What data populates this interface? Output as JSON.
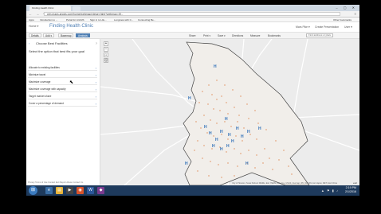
{
  "browser": {
    "tab_title": "Finding Health Clinic",
    "url": "pim.maps.arcgis.com/home/webmap/viewer.html?webmap=3f...",
    "bookmarks": [
      "Apps",
      "Introduction to ...",
      "Portal for ArcGIS",
      "Sign in to Life...",
      "Longview with C...",
      "Connecting Be..."
    ],
    "other_bookmarks": "Other bookmarks"
  },
  "app": {
    "home_label": "Home ▾",
    "title": "Finding Health Clinic",
    "user_label": "Mars Pike ▾",
    "create_presentation": "Create Presentation",
    "user_menu": "User ▾"
  },
  "toolbar": {
    "details": "Details",
    "add": "Add ▾",
    "basemap": "Basemap",
    "analysis": "Analysis",
    "share": "Share",
    "print": "Print ▾",
    "save": "Save ▾",
    "directions": "Directions",
    "measure": "Measure",
    "bookmarks": "Bookmarks",
    "find_placeholder": "Find address or place"
  },
  "panel": {
    "title": "Choose Best Facilities",
    "subtitle": "Select the option that best fits your goal",
    "options": [
      "Allocate to existing facilities",
      "Minimize travel",
      "Maximize coverage",
      "Maximize coverage with capacity",
      "Target market share",
      "Cover a percentage of demand"
    ],
    "footer": "Privacy  Terms of Use  Contact Esri  Report Abuse  Contact Us"
  },
  "map": {
    "attribution": "City of Houston, Texas Parks & Wildlife, Esri, HERE, DeLorme, USGS, Intermap, iPC, NRCAN, Esri Japan, METI, Esri China",
    "esri_logo": "esri"
  },
  "taskbar": {
    "time": "2:19 PM",
    "date": "2/1/2016"
  },
  "colors": {
    "accent": "#4f7fb3",
    "taskbar": "#1e3a5c",
    "map_background": "#ececec"
  }
}
